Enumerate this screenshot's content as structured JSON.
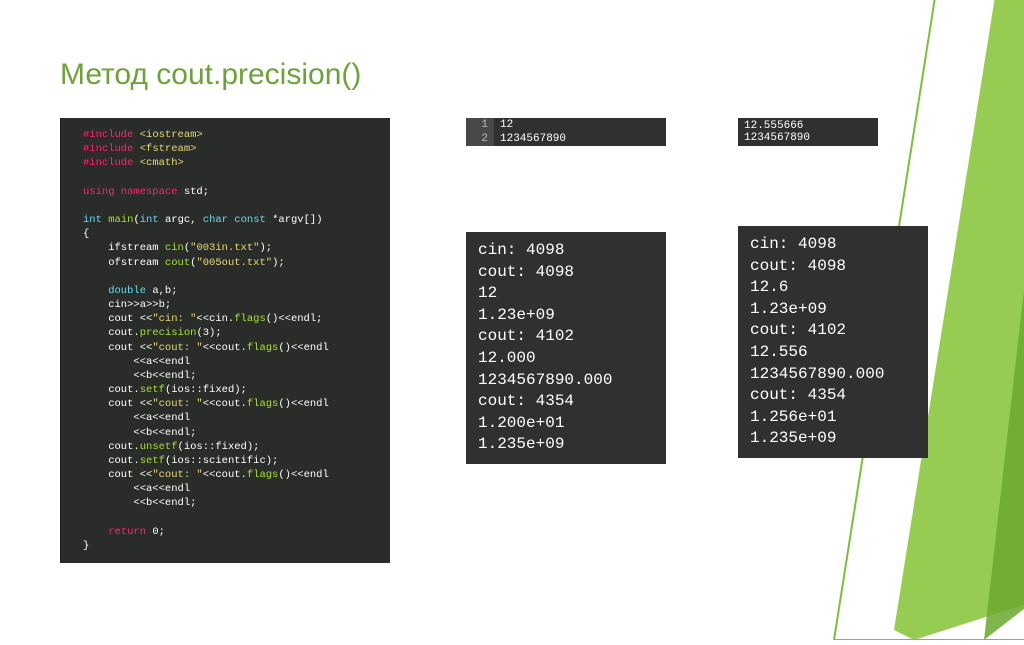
{
  "title": "Метод cout.precision()",
  "code": [
    [
      {
        "t": "#include ",
        "c": "tk-include"
      },
      {
        "t": "<iostream>",
        "c": "tk-include-str"
      }
    ],
    [
      {
        "t": "#include ",
        "c": "tk-include"
      },
      {
        "t": "<fstream>",
        "c": "tk-include-str"
      }
    ],
    [
      {
        "t": "#include ",
        "c": "tk-include"
      },
      {
        "t": "<cmath>",
        "c": "tk-include-str"
      }
    ],
    [],
    [
      {
        "t": "using namespace ",
        "c": "tk-using"
      },
      {
        "t": "std",
        "c": "tk-ns"
      },
      {
        "t": ";",
        "c": "tk-plain"
      }
    ],
    [],
    [
      {
        "t": "int ",
        "c": "tk-type"
      },
      {
        "t": "main",
        "c": "tk-func"
      },
      {
        "t": "(",
        "c": "tk-plain"
      },
      {
        "t": "int ",
        "c": "tk-type"
      },
      {
        "t": "argc, ",
        "c": "tk-plain"
      },
      {
        "t": "char const ",
        "c": "tk-type"
      },
      {
        "t": "*argv[])",
        "c": "tk-plain"
      }
    ],
    [
      {
        "t": "{",
        "c": "tk-plain"
      }
    ],
    [
      {
        "t": "    ifstream ",
        "c": "tk-plain"
      },
      {
        "t": "cin",
        "c": "tk-call"
      },
      {
        "t": "(",
        "c": "tk-plain"
      },
      {
        "t": "\"003in.txt\"",
        "c": "tk-str"
      },
      {
        "t": ");",
        "c": "tk-plain"
      }
    ],
    [
      {
        "t": "    ofstream ",
        "c": "tk-plain"
      },
      {
        "t": "cout",
        "c": "tk-call"
      },
      {
        "t": "(",
        "c": "tk-plain"
      },
      {
        "t": "\"005out.txt\"",
        "c": "tk-str"
      },
      {
        "t": ");",
        "c": "tk-plain"
      }
    ],
    [],
    [
      {
        "t": "    double ",
        "c": "tk-type"
      },
      {
        "t": "a,b;",
        "c": "tk-plain"
      }
    ],
    [
      {
        "t": "    cin>>a>>b;",
        "c": "tk-plain"
      }
    ],
    [
      {
        "t": "    cout <<",
        "c": "tk-plain"
      },
      {
        "t": "\"cin: \"",
        "c": "tk-str"
      },
      {
        "t": "<<cin.",
        "c": "tk-plain"
      },
      {
        "t": "flags",
        "c": "tk-call"
      },
      {
        "t": "()<<endl;",
        "c": "tk-plain"
      }
    ],
    [
      {
        "t": "    cout.",
        "c": "tk-plain"
      },
      {
        "t": "precision",
        "c": "tk-call"
      },
      {
        "t": "(3);",
        "c": "tk-plain"
      }
    ],
    [
      {
        "t": "    cout <<",
        "c": "tk-plain"
      },
      {
        "t": "\"cout: \"",
        "c": "tk-str"
      },
      {
        "t": "<<cout.",
        "c": "tk-plain"
      },
      {
        "t": "flags",
        "c": "tk-call"
      },
      {
        "t": "()<<endl",
        "c": "tk-plain"
      }
    ],
    [
      {
        "t": "        <<a<<endl",
        "c": "tk-plain"
      }
    ],
    [
      {
        "t": "        <<b<<endl;",
        "c": "tk-plain"
      }
    ],
    [
      {
        "t": "    cout.",
        "c": "tk-plain"
      },
      {
        "t": "setf",
        "c": "tk-call"
      },
      {
        "t": "(ios::fixed);",
        "c": "tk-plain"
      }
    ],
    [
      {
        "t": "    cout <<",
        "c": "tk-plain"
      },
      {
        "t": "\"cout: \"",
        "c": "tk-str"
      },
      {
        "t": "<<cout.",
        "c": "tk-plain"
      },
      {
        "t": "flags",
        "c": "tk-call"
      },
      {
        "t": "()<<endl",
        "c": "tk-plain"
      }
    ],
    [
      {
        "t": "        <<a<<endl",
        "c": "tk-plain"
      }
    ],
    [
      {
        "t": "        <<b<<endl;",
        "c": "tk-plain"
      }
    ],
    [
      {
        "t": "    cout.",
        "c": "tk-plain"
      },
      {
        "t": "unsetf",
        "c": "tk-call"
      },
      {
        "t": "(ios::fixed);",
        "c": "tk-plain"
      }
    ],
    [
      {
        "t": "    cout.",
        "c": "tk-plain"
      },
      {
        "t": "setf",
        "c": "tk-call"
      },
      {
        "t": "(ios::scientific);",
        "c": "tk-plain"
      }
    ],
    [
      {
        "t": "    cout <<",
        "c": "tk-plain"
      },
      {
        "t": "\"cout: \"",
        "c": "tk-str"
      },
      {
        "t": "<<cout.",
        "c": "tk-plain"
      },
      {
        "t": "flags",
        "c": "tk-call"
      },
      {
        "t": "()<<endl",
        "c": "tk-plain"
      }
    ],
    [
      {
        "t": "        <<a<<endl",
        "c": "tk-plain"
      }
    ],
    [
      {
        "t": "        <<b<<endl;",
        "c": "tk-plain"
      }
    ],
    [],
    [
      {
        "t": "    return ",
        "c": "tk-kw"
      },
      {
        "t": "0;",
        "c": "tk-plain"
      }
    ],
    [
      {
        "t": "}",
        "c": "tk-plain"
      }
    ]
  ],
  "input1": [
    {
      "ln": "1",
      "val": "12"
    },
    {
      "ln": "2",
      "val": "1234567890"
    }
  ],
  "input2": [
    "12.555666",
    "1234567890"
  ],
  "outLeft": [
    "cin: 4098",
    "cout: 4098",
    "12",
    "1.23e+09",
    "cout: 4102",
    "12.000",
    "1234567890.000",
    "cout: 4354",
    "1.200e+01",
    "1.235e+09"
  ],
  "outRight": [
    "cin: 4098",
    "cout: 4098",
    "12.6",
    "1.23e+09",
    "cout: 4102",
    "12.556",
    "1234567890.000",
    "cout: 4354",
    "1.256e+01",
    "1.235e+09"
  ]
}
